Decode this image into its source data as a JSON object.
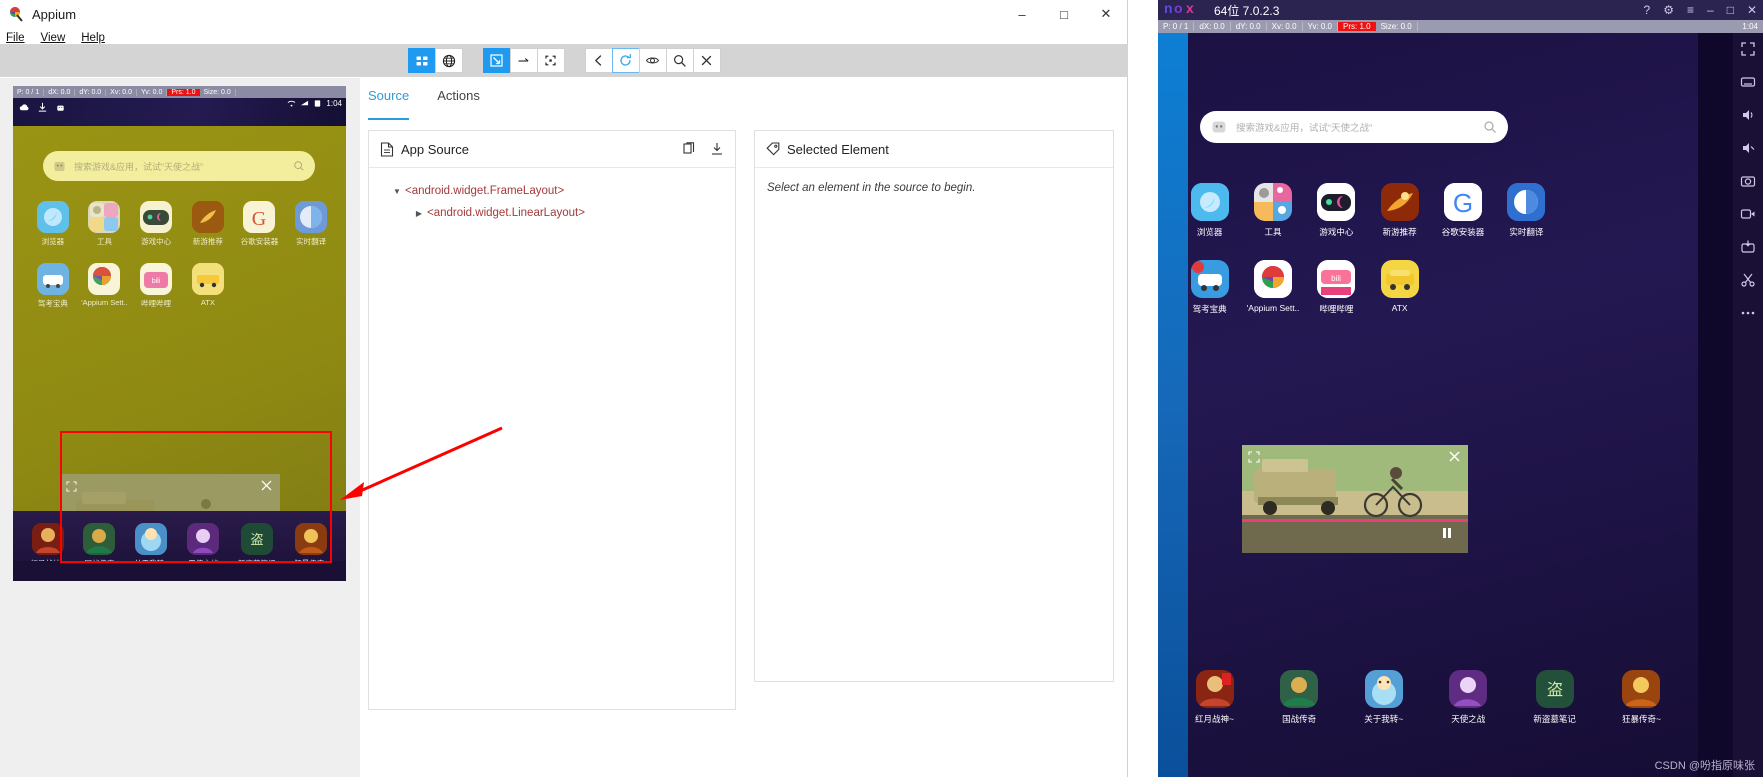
{
  "appium": {
    "title": "Appium",
    "logo_icon": "appium-logo",
    "menu": [
      {
        "label": "File",
        "name": "menu-file"
      },
      {
        "label": "View",
        "name": "menu-view"
      },
      {
        "label": "Help",
        "name": "menu-help"
      }
    ],
    "window_controls": [
      {
        "icon": "minimize-icon",
        "glyph": "–",
        "name": "minimize-button"
      },
      {
        "icon": "maximize-icon",
        "glyph": "□",
        "name": "maximize-button"
      },
      {
        "icon": "close-icon",
        "glyph": "✕",
        "name": "close-button"
      }
    ],
    "toolbar": {
      "groups": [
        {
          "buttons": [
            {
              "icon": "grid-layout-icon",
              "name": "toolbar-layout-grid",
              "active": true
            },
            {
              "icon": "globe-icon",
              "name": "toolbar-web-context",
              "active": false
            }
          ]
        },
        {
          "buttons": [
            {
              "icon": "select-element-icon",
              "name": "toolbar-select-element",
              "active": true
            },
            {
              "icon": "swipe-arrow-icon",
              "name": "toolbar-swipe",
              "active": false
            },
            {
              "icon": "tap-by-coordinates-icon",
              "name": "toolbar-tap-coordinates",
              "active": false
            }
          ]
        },
        {
          "buttons": [
            {
              "icon": "back-arrow-icon",
              "name": "toolbar-back",
              "active": false
            },
            {
              "icon": "refresh-icon",
              "name": "toolbar-refresh-source",
              "active": false,
              "selected": true
            },
            {
              "icon": "eye-icon",
              "name": "toolbar-start-recording",
              "active": false
            },
            {
              "icon": "search-icon",
              "name": "toolbar-search-element",
              "active": false
            },
            {
              "icon": "close-x-icon",
              "name": "toolbar-quit-session",
              "active": false
            }
          ]
        }
      ]
    },
    "tabs": [
      {
        "label": "Source",
        "name": "tab-source",
        "active": true
      },
      {
        "label": "Actions",
        "name": "tab-actions",
        "active": false
      }
    ],
    "app_source": {
      "title": "App Source",
      "icon": "document-icon",
      "actions": [
        {
          "icon": "copy-icon",
          "name": "copy-source-button"
        },
        {
          "icon": "download-icon",
          "name": "download-source-button"
        }
      ],
      "tree": [
        {
          "label": "<android.widget.FrameLayout>",
          "depth": 0,
          "caret": "▼",
          "expanded": true
        },
        {
          "label": "<android.widget.LinearLayout>",
          "depth": 1,
          "caret": "▶",
          "expanded": false
        }
      ]
    },
    "selected_element": {
      "title": "Selected Element",
      "icon": "tag-icon",
      "empty_text": "Select an element in the source to begin."
    }
  },
  "mirror": {
    "nox_status": [
      {
        "text": "P: 0 / 1"
      },
      {
        "text": "dX: 0.0"
      },
      {
        "text": "dY: 0.0"
      },
      {
        "text": "Xv: 0.0"
      },
      {
        "text": "Yv: 0.0"
      },
      {
        "text": "Prs: 1.0",
        "highlight": true
      },
      {
        "text": "Size: 0.0"
      }
    ],
    "clock": "1:04",
    "search_placeholder": "搜索游戏&应用，试试“天使之战”",
    "search_icon": "search-icon",
    "apps_row1": [
      {
        "label": "浏览器",
        "icon": "browser-icon",
        "color": "#39b6ef"
      },
      {
        "label": "工具",
        "icon": "tools-folder-icon",
        "color": "#e0e0e0"
      },
      {
        "label": "游戏中心",
        "icon": "game-center-icon",
        "color": "#ffffff"
      },
      {
        "label": "新游推荐",
        "icon": "new-games-icon",
        "color": "#c3370d"
      },
      {
        "label": "谷歌安装器",
        "icon": "google-installer-icon",
        "color": "#ffffff"
      },
      {
        "label": "实时翻译",
        "icon": "translate-icon",
        "color": "#3b7bdd"
      }
    ],
    "apps_row2": [
      {
        "label": "驾考宝典",
        "icon": "driving-test-icon",
        "color": "#2a8fe0"
      },
      {
        "label": "'Appium Sett..",
        "icon": "appium-settings-icon",
        "color": "#ffffff"
      },
      {
        "label": "哔哩哔哩",
        "icon": "bilibili-icon",
        "color": "#ffffff"
      },
      {
        "label": "ATX",
        "icon": "atx-icon",
        "color": "#f5d442"
      }
    ],
    "ad": {
      "close_icon": "close-x-icon",
      "expand_icon": "expand-icon",
      "prev_icon": "prev-track-icon",
      "play_icon": "play-icon",
      "next_icon": "next-track-icon"
    },
    "dock_apps": [
      {
        "label": "红月战神~",
        "icon": "game-hongyue-icon",
        "color": "#8b1a1a"
      },
      {
        "label": "国战传奇",
        "icon": "game-guozhan-icon",
        "color": "#2e6b4a"
      },
      {
        "label": "关于我转~",
        "icon": "game-slime-icon",
        "color": "#3a7fc1"
      },
      {
        "label": "天使之战",
        "icon": "game-angel-icon",
        "color": "#5a2a7a"
      },
      {
        "label": "新盗墓笔记",
        "icon": "game-tomb-icon",
        "color": "#23503a"
      },
      {
        "label": "狂暴传奇~",
        "icon": "game-kuangbao-icon",
        "color": "#9a4a12"
      }
    ]
  },
  "nox": {
    "brand": "nox",
    "version": "64位 7.0.2.3",
    "title_icons": [
      {
        "icon": "help-icon",
        "glyph": "?",
        "name": "nox-help-button"
      },
      {
        "icon": "gear-icon",
        "glyph": "⚙",
        "name": "nox-settings-button"
      },
      {
        "icon": "menu-icon",
        "glyph": "≡",
        "name": "nox-menu-button"
      },
      {
        "icon": "minimize-icon",
        "glyph": "–",
        "name": "nox-minimize-button"
      },
      {
        "icon": "maximize-icon",
        "glyph": "□",
        "name": "nox-maximize-button"
      },
      {
        "icon": "close-icon",
        "glyph": "✕",
        "name": "nox-close-button"
      }
    ],
    "status": [
      {
        "text": "P: 0 / 1"
      },
      {
        "text": "dX: 0.0"
      },
      {
        "text": "dY: 0.0"
      },
      {
        "text": "Xv: 0.0"
      },
      {
        "text": "Yv: 0.0"
      },
      {
        "text": "Prs: 1.0",
        "highlight": true
      },
      {
        "text": "Size: 0.0"
      }
    ],
    "clock": "1:04",
    "search_placeholder": "搜索游戏&应用，试试“天使之战”",
    "sidebar_icons": [
      {
        "icon": "fullscreen-icon",
        "name": "nox-fullscreen-button"
      },
      {
        "icon": "keyboard-icon",
        "name": "nox-keyboard-button"
      },
      {
        "icon": "volume-up-icon",
        "name": "nox-volume-up-button"
      },
      {
        "icon": "volume-down-icon",
        "name": "nox-volume-down-button"
      },
      {
        "icon": "screenshot-icon",
        "name": "nox-screenshot-button"
      },
      {
        "icon": "record-icon",
        "name": "nox-record-button"
      },
      {
        "icon": "install-apk-icon",
        "name": "nox-install-apk-button"
      },
      {
        "icon": "scissors-icon",
        "name": "nox-cut-button"
      },
      {
        "icon": "more-icon",
        "name": "nox-more-button"
      }
    ],
    "watermark": "CSDN @吩指原味张"
  },
  "colors": {
    "accent_blue": "#1e9bf0",
    "tab_active": "#2d9cdb",
    "tag_red": "#a33a3a",
    "annotation_red": "#ff0000"
  }
}
